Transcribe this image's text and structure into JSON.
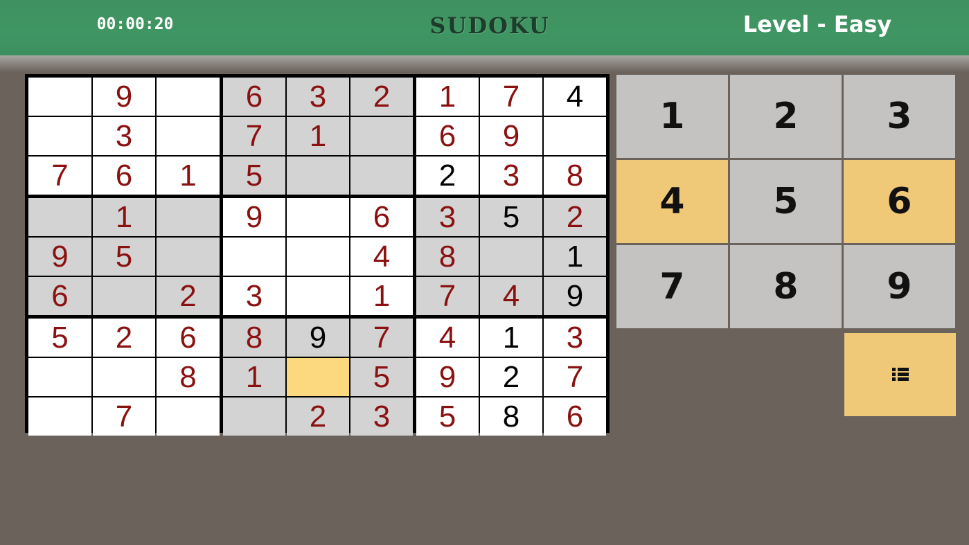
{
  "header": {
    "timer": "00:00:20",
    "title": "SUDOKU",
    "level": "Level - Easy"
  },
  "colors": {
    "header_green": "#3f9663",
    "background": "#6b625c",
    "given_digit": "#000000",
    "entered_digit": "#8b1111",
    "white_cell": "#ffffff",
    "shaded_cell": "#d3d3d3",
    "selected_cell": "#fcd97f",
    "key_normal": "#c4c3c1",
    "key_highlight": "#efc878"
  },
  "board": {
    "selected": [
      7,
      4
    ],
    "grid": [
      [
        "",
        "9",
        "",
        "6",
        "3",
        "2",
        "1",
        "7",
        "4"
      ],
      [
        "",
        "3",
        "",
        "7",
        "1",
        "",
        "6",
        "9",
        ""
      ],
      [
        "7",
        "6",
        "1",
        "5",
        "",
        "",
        "2",
        "3",
        "8"
      ],
      [
        "",
        "1",
        "",
        "9",
        "",
        "6",
        "3",
        "5",
        "2"
      ],
      [
        "9",
        "5",
        "",
        "",
        "",
        "4",
        "8",
        "",
        "1"
      ],
      [
        "6",
        "",
        "2",
        "3",
        "",
        "1",
        "7",
        "4",
        "9"
      ],
      [
        "5",
        "2",
        "6",
        "8",
        "9",
        "7",
        "4",
        "1",
        "3"
      ],
      [
        "",
        "",
        "8",
        "1",
        "",
        "5",
        "9",
        "2",
        "7"
      ],
      [
        "",
        "7",
        "",
        "",
        "2",
        "3",
        "5",
        "8",
        "6"
      ]
    ],
    "kind": [
      [
        "",
        "e",
        "",
        "e",
        "e",
        "e",
        "e",
        "e",
        "g"
      ],
      [
        "",
        "e",
        "",
        "e",
        "e",
        "",
        "e",
        "e",
        ""
      ],
      [
        "e",
        "e",
        "e",
        "e",
        "",
        "",
        "g",
        "e",
        "e"
      ],
      [
        "",
        "e",
        "",
        "e",
        "",
        "e",
        "e",
        "g",
        "e"
      ],
      [
        "e",
        "e",
        "",
        "",
        "",
        "e",
        "e",
        "",
        "g"
      ],
      [
        "e",
        "",
        "e",
        "e",
        "",
        "e",
        "e",
        "e",
        "g"
      ],
      [
        "e",
        "e",
        "e",
        "e",
        "g",
        "e",
        "e",
        "g",
        "e"
      ],
      [
        "",
        "",
        "e",
        "e",
        "",
        "e",
        "e",
        "g",
        "e"
      ],
      [
        "",
        "e",
        "",
        "",
        "e",
        "e",
        "e",
        "g",
        "e"
      ]
    ]
  },
  "keypad": {
    "keys": [
      {
        "label": "1",
        "highlight": false
      },
      {
        "label": "2",
        "highlight": false
      },
      {
        "label": "3",
        "highlight": false
      },
      {
        "label": "4",
        "highlight": true
      },
      {
        "label": "5",
        "highlight": false
      },
      {
        "label": "6",
        "highlight": true
      },
      {
        "label": "7",
        "highlight": false
      },
      {
        "label": "8",
        "highlight": false
      },
      {
        "label": "9",
        "highlight": false
      }
    ],
    "menu_icon": "list-icon"
  }
}
